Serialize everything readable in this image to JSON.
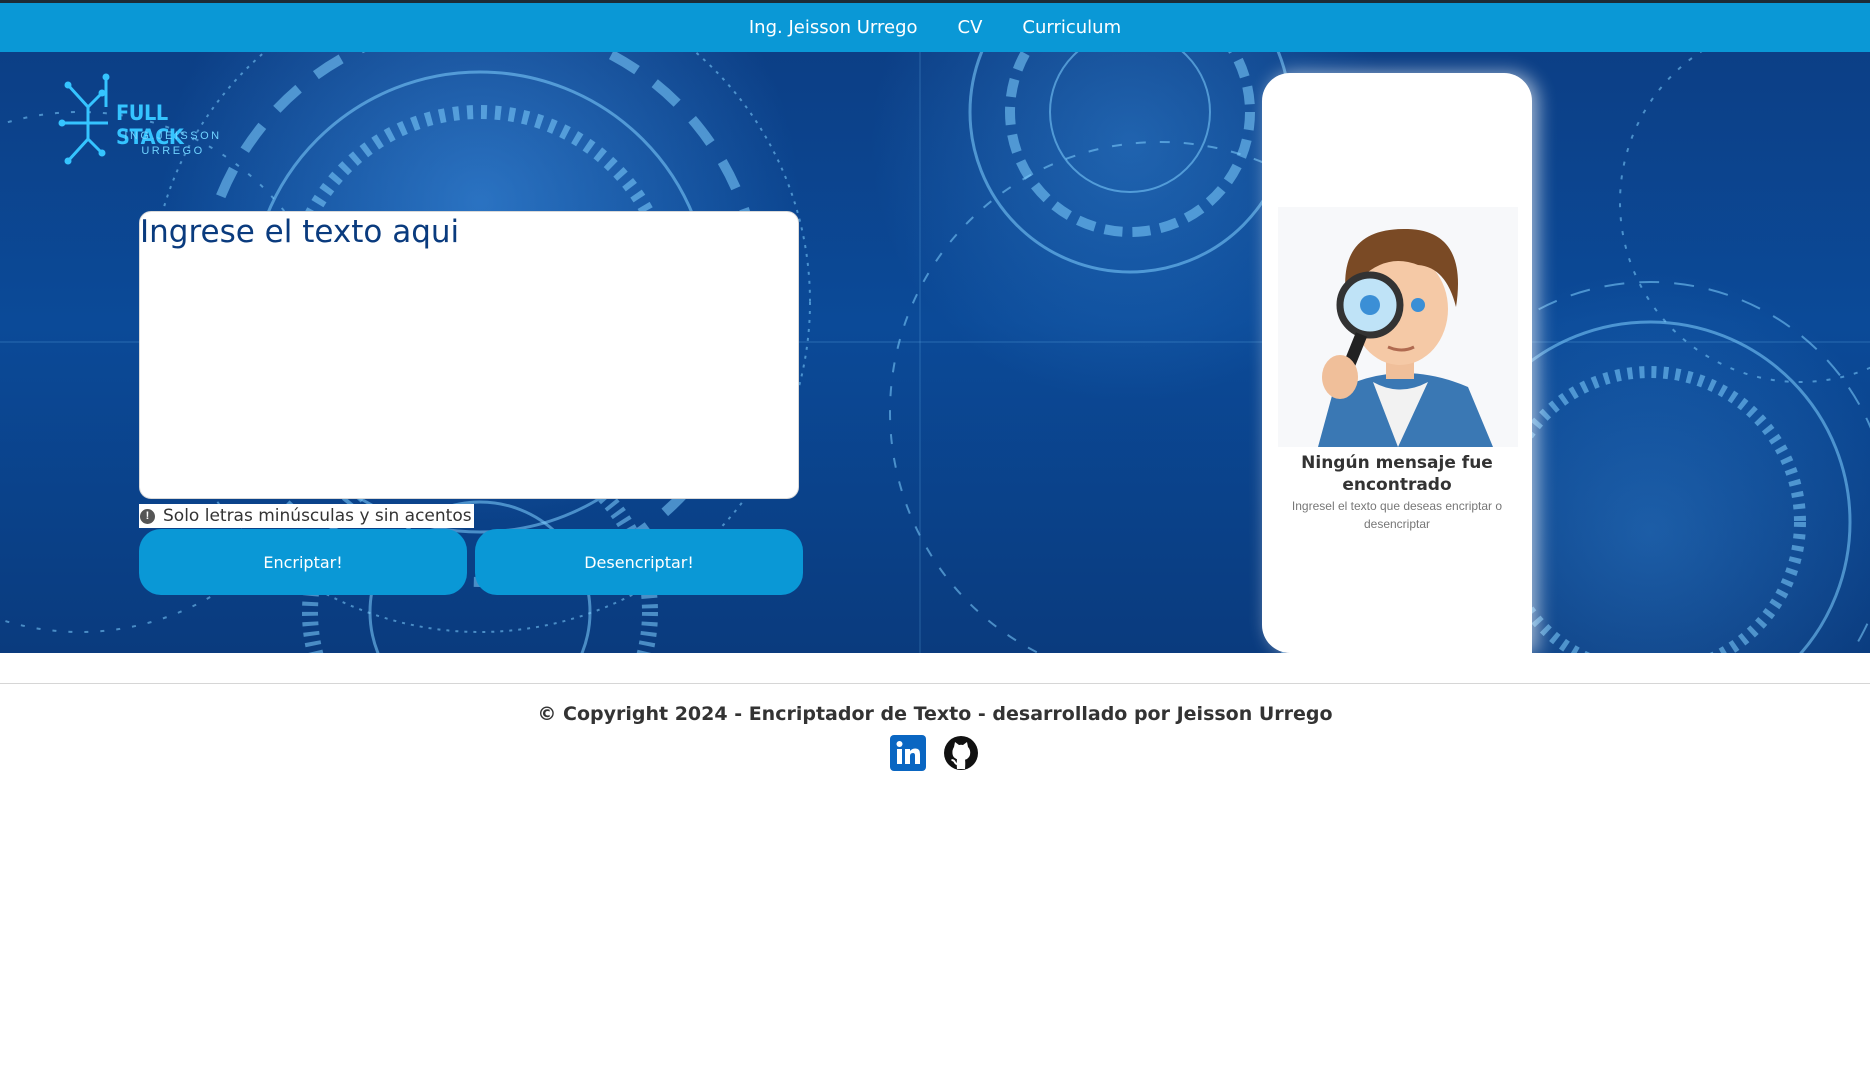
{
  "nav": {
    "items": [
      {
        "label": "Ing. Jeisson Urrego"
      },
      {
        "label": "CV"
      },
      {
        "label": "Curriculum"
      }
    ]
  },
  "logo": {
    "title": "FULL STACK",
    "subtitle_line1": "ING.JEISSON",
    "subtitle_line2": "URREGO"
  },
  "editor": {
    "placeholder": "Ingrese el texto aqui",
    "value": ""
  },
  "hint": {
    "icon": "exclamation-circle-icon",
    "text": "Solo letras minúsculas y sin acentos"
  },
  "buttons": {
    "encrypt_label": "Encriptar!",
    "decrypt_label": "Desencriptar!"
  },
  "result_panel": {
    "title": "Ningún mensaje fue encontrado",
    "description": "Ingresel el texto que deseas encriptar o desencriptar"
  },
  "footer": {
    "copyright": "© Copyright 2024 - Encriptador de Texto - desarrollado por Jeisson Urrego",
    "social": [
      {
        "icon": "linkedin-icon",
        "color": "#0a66c2"
      },
      {
        "icon": "github-icon",
        "color": "#111111"
      }
    ]
  },
  "colors": {
    "accent": "#0a98d6",
    "hero_background": "#0b4a98",
    "text_dark": "#333333"
  }
}
